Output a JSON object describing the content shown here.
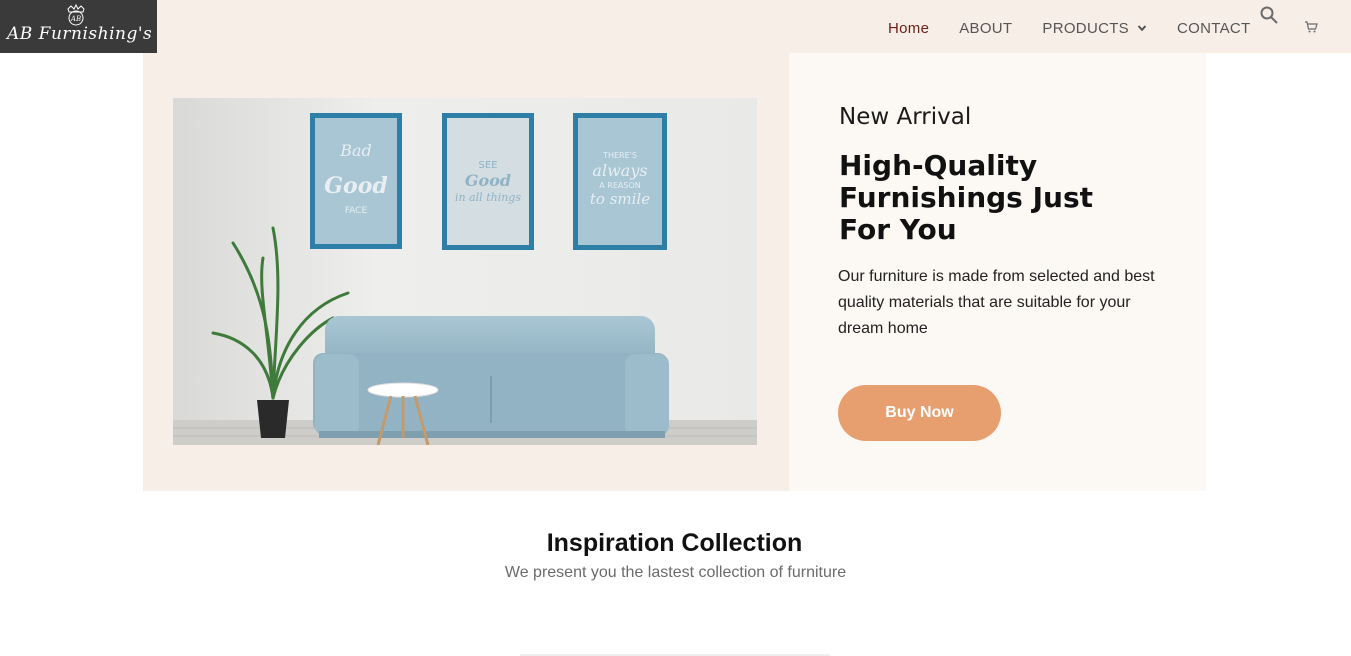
{
  "brand": {
    "name": "AB Furnishing's",
    "crest_letters": "AB"
  },
  "nav": {
    "home": "Home",
    "about": "ABOUT",
    "products": "PRODUCTS",
    "contact": "CONTACT"
  },
  "icons": {
    "search": "search-icon",
    "cart": "cart-icon",
    "chevron": "chevron-down-icon"
  },
  "hero": {
    "eyebrow": "New Arrival",
    "headline": "High-Quality Furnishings Just For You",
    "description": "Our furniture is made from selected and best quality materials that are suitable for your dream home",
    "button": "Buy Now",
    "posters": [
      "Bad Good FACE",
      "SEE Good in all things",
      "THERE'S always A REASON to smile"
    ]
  },
  "section": {
    "title": "Inspiration Collection",
    "subtitle": "We present you the lastest collection of furniture"
  },
  "colors": {
    "header_bg": "#f7efe7",
    "logo_bg": "#3a3a3a",
    "nav_active": "#6b1f17",
    "nav_text": "#555555",
    "hero_left_bg": "#f7efe7",
    "hero_right_bg": "#fcf8f4",
    "button_bg": "#e89f70",
    "button_text": "#ffffff"
  }
}
